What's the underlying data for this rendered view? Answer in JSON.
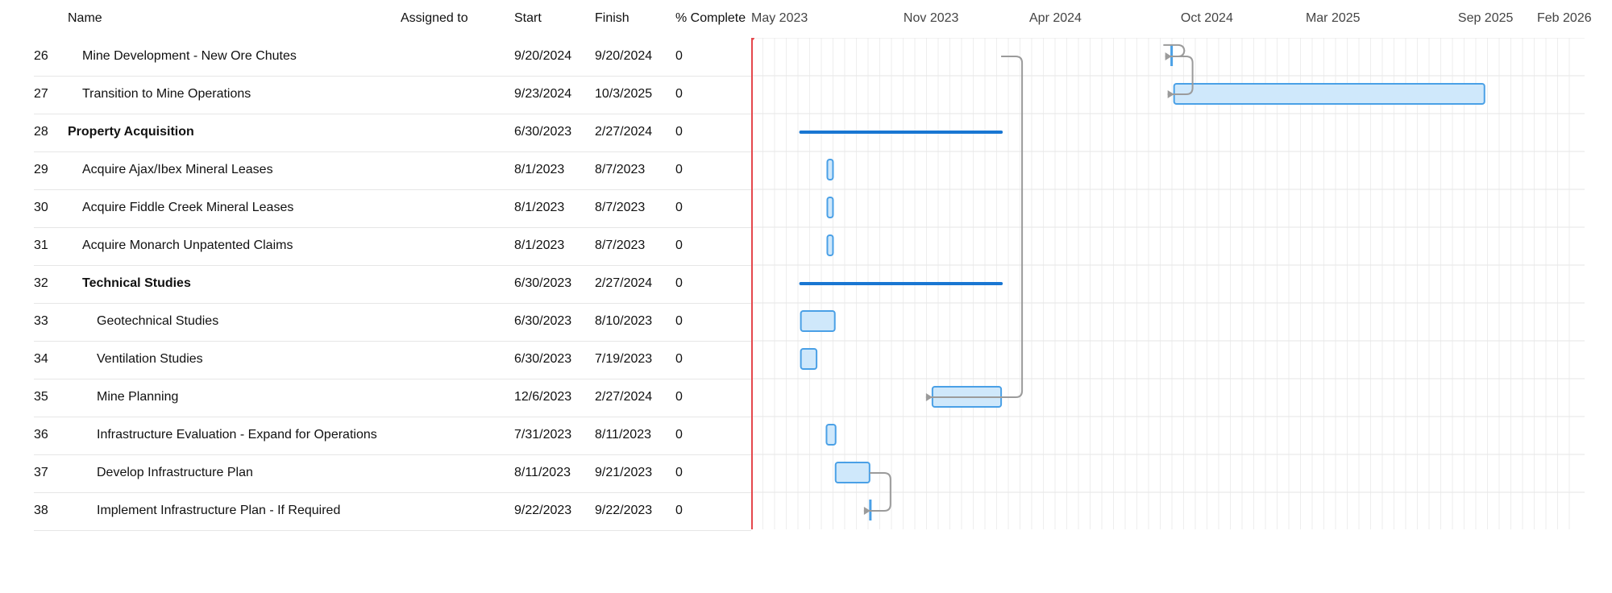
{
  "columns": {
    "name": "Name",
    "assigned_to": "Assigned to",
    "start": "Start",
    "finish": "Finish",
    "complete": "% Complete"
  },
  "timeline": {
    "labels": [
      "May 2023",
      "Nov 2023",
      "Apr 2024",
      "Oct 2024",
      "Mar 2025",
      "Sep 2025",
      "Feb 2026"
    ],
    "today_marker_color": "#e5484d",
    "grid_color": "#eeeeee",
    "bar_fill": "#cfe8fb",
    "bar_stroke": "#4aa0e6",
    "summary_color": "#1976d2",
    "dependency_color": "#9b9b9b"
  },
  "tasks": [
    {
      "id": "26",
      "name": "Mine Development - New Ore Chutes",
      "assigned": "",
      "start": "9/20/2024",
      "finish": "9/20/2024",
      "complete": "0",
      "indent": 1,
      "summary": false,
      "milestone": true,
      "bar_start": "2024-09-20",
      "bar_finish": "2024-09-20"
    },
    {
      "id": "27",
      "name": "Transition to Mine Operations",
      "assigned": "",
      "start": "9/23/2024",
      "finish": "10/3/2025",
      "complete": "0",
      "indent": 1,
      "summary": false,
      "milestone": false,
      "bar_start": "2024-09-23",
      "bar_finish": "2025-10-03"
    },
    {
      "id": "28",
      "name": "Property Acquisition",
      "assigned": "",
      "start": "6/30/2023",
      "finish": "2/27/2024",
      "complete": "0",
      "indent": 0,
      "summary": true,
      "milestone": false,
      "bar_start": "2023-06-30",
      "bar_finish": "2024-02-27"
    },
    {
      "id": "29",
      "name": "Acquire Ajax/Ibex Mineral Leases",
      "assigned": "",
      "start": "8/1/2023",
      "finish": "8/7/2023",
      "complete": "0",
      "indent": 1,
      "summary": false,
      "milestone": false,
      "bar_start": "2023-08-01",
      "bar_finish": "2023-08-07"
    },
    {
      "id": "30",
      "name": "Acquire Fiddle Creek Mineral Leases",
      "assigned": "",
      "start": "8/1/2023",
      "finish": "8/7/2023",
      "complete": "0",
      "indent": 1,
      "summary": false,
      "milestone": false,
      "bar_start": "2023-08-01",
      "bar_finish": "2023-08-07"
    },
    {
      "id": "31",
      "name": "Acquire Monarch Unpatented Claims",
      "assigned": "",
      "start": "8/1/2023",
      "finish": "8/7/2023",
      "complete": "0",
      "indent": 1,
      "summary": false,
      "milestone": false,
      "bar_start": "2023-08-01",
      "bar_finish": "2023-08-07"
    },
    {
      "id": "32",
      "name": "Technical Studies",
      "assigned": "",
      "start": "6/30/2023",
      "finish": "2/27/2024",
      "complete": "0",
      "indent": 1,
      "summary": true,
      "milestone": false,
      "bar_start": "2023-06-30",
      "bar_finish": "2024-02-27"
    },
    {
      "id": "33",
      "name": "Geotechnical Studies",
      "assigned": "",
      "start": "6/30/2023",
      "finish": "8/10/2023",
      "complete": "0",
      "indent": 2,
      "summary": false,
      "milestone": false,
      "bar_start": "2023-06-30",
      "bar_finish": "2023-08-10"
    },
    {
      "id": "34",
      "name": "Ventilation Studies",
      "assigned": "",
      "start": "6/30/2023",
      "finish": "7/19/2023",
      "complete": "0",
      "indent": 2,
      "summary": false,
      "milestone": false,
      "bar_start": "2023-06-30",
      "bar_finish": "2023-07-19"
    },
    {
      "id": "35",
      "name": "Mine Planning",
      "assigned": "",
      "start": "12/6/2023",
      "finish": "2/27/2024",
      "complete": "0",
      "indent": 2,
      "summary": false,
      "milestone": false,
      "bar_start": "2023-12-06",
      "bar_finish": "2024-02-27"
    },
    {
      "id": "36",
      "name": "Infrastructure Evaluation - Expand for Operations",
      "assigned": "",
      "start": "7/31/2023",
      "finish": "8/11/2023",
      "complete": "0",
      "indent": 2,
      "summary": false,
      "milestone": false,
      "bar_start": "2023-07-31",
      "bar_finish": "2023-08-11"
    },
    {
      "id": "37",
      "name": "Develop Infrastructure Plan",
      "assigned": "",
      "start": "8/11/2023",
      "finish": "9/21/2023",
      "complete": "0",
      "indent": 2,
      "summary": false,
      "milestone": false,
      "bar_start": "2023-08-11",
      "bar_finish": "2023-09-21"
    },
    {
      "id": "38",
      "name": "Implement Infrastructure Plan - If Required",
      "assigned": "",
      "start": "9/22/2023",
      "finish": "9/22/2023",
      "complete": "0",
      "indent": 2,
      "summary": false,
      "milestone": true,
      "bar_start": "2023-09-22",
      "bar_finish": "2023-09-22"
    }
  ]
}
